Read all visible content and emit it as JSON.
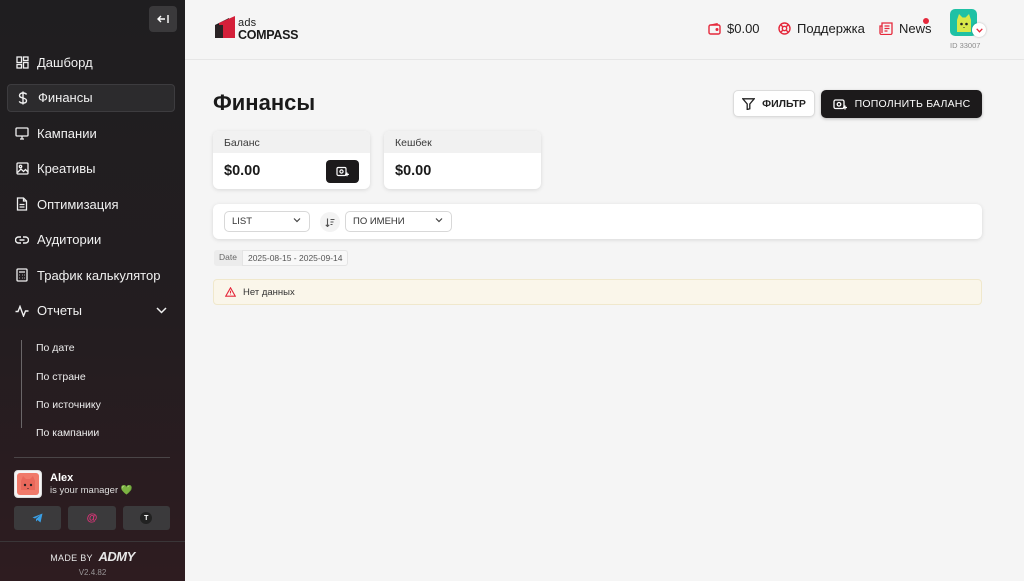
{
  "colors": {
    "accent_red": "#e5283b",
    "sidebar_bg": "#1f1e20",
    "dark_button": "#1c1a1b",
    "alert_bg": "#faf6ea",
    "avatar_teal": "#1fc1a5"
  },
  "sidebar": {
    "items": [
      {
        "label": "Дашборд",
        "icon": "grid-icon"
      },
      {
        "label": "Финансы",
        "icon": "dollar-icon",
        "active": true
      },
      {
        "label": "Кампании",
        "icon": "monitor-icon"
      },
      {
        "label": "Креативы",
        "icon": "image-icon"
      },
      {
        "label": "Оптимизация",
        "icon": "document-icon"
      },
      {
        "label": "Аудитории",
        "icon": "link-icon"
      },
      {
        "label": "Трафик калькулятор",
        "icon": "calculator-icon"
      },
      {
        "label": "Отчеты",
        "icon": "activity-icon",
        "expanded": true
      }
    ],
    "reports_sub": [
      "По дате",
      "По стране",
      "По источнику",
      "По кампании"
    ],
    "manager": {
      "name": "Alex",
      "role": "is your manager",
      "heart": "💚",
      "contacts": [
        "telegram-icon",
        "email-icon",
        "teams-icon"
      ],
      "contact_glyphs": {
        "email": "@",
        "teams": "T"
      }
    },
    "made_by": "MADE BY",
    "made_by_brand": "ADMY",
    "version": "V2.4.82"
  },
  "header": {
    "logo_top": "ads",
    "logo_bottom": "COMPASS",
    "balance": "$0.00",
    "support": "Поддержка",
    "news": "News",
    "user_id": "ID 33007"
  },
  "main": {
    "title": "Финансы",
    "filter_label": "ФИЛЬТР",
    "topup_label": "ПОПОЛНИТЬ БАЛАНС",
    "cards": [
      {
        "label": "Баланс",
        "value": "$0.00"
      },
      {
        "label": "Кешбек",
        "value": "$0.00"
      }
    ],
    "view_select": "LIST",
    "sort_select": "ПО ИМЕНИ",
    "date_key": "Date",
    "date_range": "2025-08-15 - 2025-09-14",
    "empty_message": "Нет данных"
  }
}
